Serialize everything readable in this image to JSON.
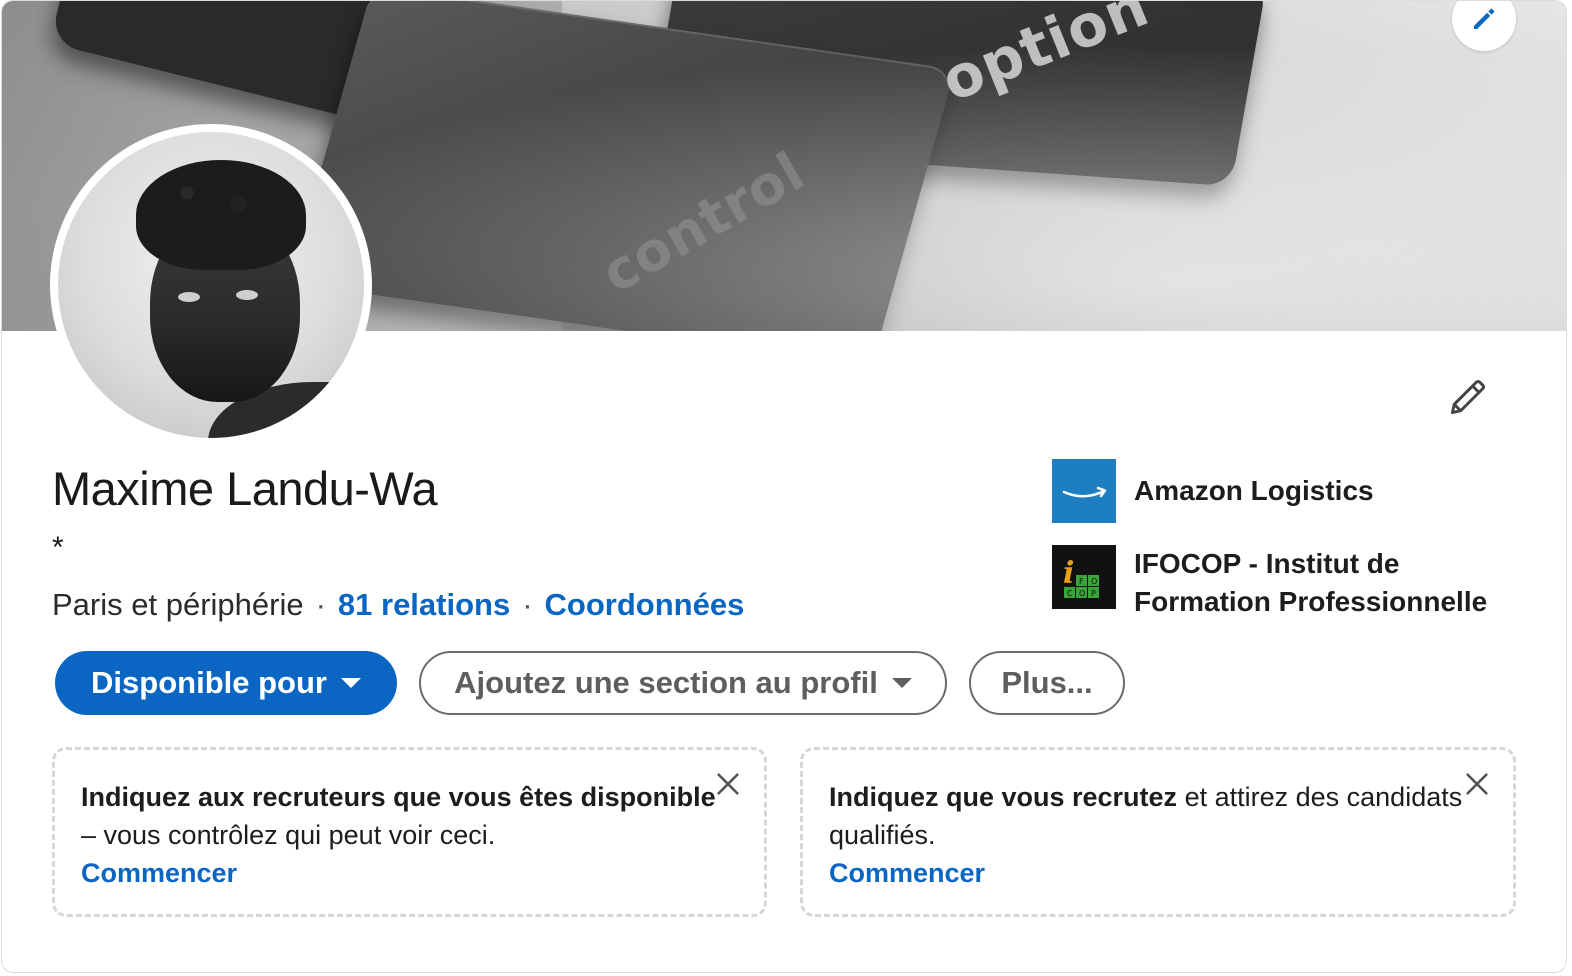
{
  "banner": {
    "key_control_label": "control",
    "key_option_label": "option"
  },
  "profile": {
    "name": "Maxime Landu-Wa",
    "headline": "*",
    "location": "Paris et périphérie",
    "connections": "81 relations",
    "contact_info": "Coordonnées"
  },
  "experience": [
    {
      "name": "Amazon Logistics",
      "logo": "amazon-logo"
    },
    {
      "name": "IFOCOP - Institut de Formation Professionnelle",
      "logo": "ifocop-logo"
    }
  ],
  "actions": {
    "open_to": "Disponible pour",
    "add_section": "Ajoutez une section au profil",
    "more": "Plus..."
  },
  "prompts": [
    {
      "bold": "Indiquez aux recruteurs que vous êtes disponible",
      "text": " – vous contrôlez qui peut voir ceci.",
      "link": "Commencer"
    },
    {
      "bold": "Indiquez que vous recrutez",
      "text": " et attirez des candidats qualifiés.",
      "link": "Commencer"
    }
  ],
  "colors": {
    "accent": "#0a66c2",
    "amazon_logo_bg": "#1d7fc2",
    "ifocop_logo_bg": "#111111"
  },
  "icons": [
    "pencil-icon",
    "edit-icon",
    "caret-down-icon",
    "close-icon"
  ]
}
